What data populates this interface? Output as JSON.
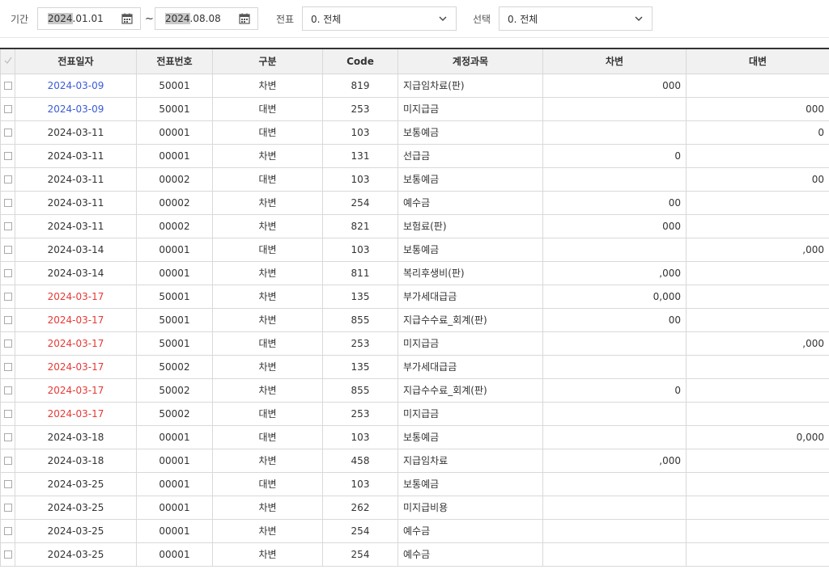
{
  "filters": {
    "period_label": "기간",
    "start_date_highlight": "2024",
    "start_date_rest": ".01.01",
    "tilde": "~",
    "end_date_highlight": "2024",
    "end_date_rest": ".08.08",
    "voucher_label": "전표",
    "voucher_value": "0. 전체",
    "select_label": "선택",
    "select_value": "0. 전체"
  },
  "table": {
    "headers": [
      "전표일자",
      "전표번호",
      "구분",
      "Code",
      "계정과목",
      "차변",
      "대변"
    ],
    "rows": [
      {
        "date": "2024-03-09",
        "color": "blue",
        "no": "50001",
        "type": "차변",
        "code": "819",
        "account": "지급임차료(판)",
        "debit": "000",
        "credit": ""
      },
      {
        "date": "2024-03-09",
        "color": "blue",
        "no": "50001",
        "type": "대변",
        "code": "253",
        "account": "미지급금",
        "debit": "",
        "credit": "000"
      },
      {
        "date": "2024-03-11",
        "color": "default",
        "no": "00001",
        "type": "대변",
        "code": "103",
        "account": "보통예금",
        "debit": "",
        "credit": "0"
      },
      {
        "date": "2024-03-11",
        "color": "default",
        "no": "00001",
        "type": "차변",
        "code": "131",
        "account": "선급금",
        "debit": "0",
        "credit": ""
      },
      {
        "date": "2024-03-11",
        "color": "default",
        "no": "00002",
        "type": "대변",
        "code": "103",
        "account": "보통예금",
        "debit": "",
        "credit": "00"
      },
      {
        "date": "2024-03-11",
        "color": "default",
        "no": "00002",
        "type": "차변",
        "code": "254",
        "account": "예수금",
        "debit": "00",
        "credit": ""
      },
      {
        "date": "2024-03-11",
        "color": "default",
        "no": "00002",
        "type": "차변",
        "code": "821",
        "account": "보험료(판)",
        "debit": "000",
        "credit": ""
      },
      {
        "date": "2024-03-14",
        "color": "default",
        "no": "00001",
        "type": "대변",
        "code": "103",
        "account": "보통예금",
        "debit": "",
        "credit": ",000"
      },
      {
        "date": "2024-03-14",
        "color": "default",
        "no": "00001",
        "type": "차변",
        "code": "811",
        "account": "복리후생비(판)",
        "debit": ",000",
        "credit": ""
      },
      {
        "date": "2024-03-17",
        "color": "red",
        "no": "50001",
        "type": "차변",
        "code": "135",
        "account": "부가세대급금",
        "debit": "0,000",
        "credit": ""
      },
      {
        "date": "2024-03-17",
        "color": "red",
        "no": "50001",
        "type": "차변",
        "code": "855",
        "account": "지급수수료_회계(판)",
        "debit": "00",
        "credit": ""
      },
      {
        "date": "2024-03-17",
        "color": "red",
        "no": "50001",
        "type": "대변",
        "code": "253",
        "account": "미지급금",
        "debit": "",
        "credit": ",000"
      },
      {
        "date": "2024-03-17",
        "color": "red",
        "no": "50002",
        "type": "차변",
        "code": "135",
        "account": "부가세대급금",
        "debit": "",
        "credit": ""
      },
      {
        "date": "2024-03-17",
        "color": "red",
        "no": "50002",
        "type": "차변",
        "code": "855",
        "account": "지급수수료_회계(판)",
        "debit": "0",
        "credit": ""
      },
      {
        "date": "2024-03-17",
        "color": "red",
        "no": "50002",
        "type": "대변",
        "code": "253",
        "account": "미지급금",
        "debit": "",
        "credit": ""
      },
      {
        "date": "2024-03-18",
        "color": "default",
        "no": "00001",
        "type": "대변",
        "code": "103",
        "account": "보통예금",
        "debit": "",
        "credit": "0,000"
      },
      {
        "date": "2024-03-18",
        "color": "default",
        "no": "00001",
        "type": "차변",
        "code": "458",
        "account": "지급임차료",
        "debit": ",000",
        "credit": ""
      },
      {
        "date": "2024-03-25",
        "color": "default",
        "no": "00001",
        "type": "대변",
        "code": "103",
        "account": "보통예금",
        "debit": "",
        "credit": ""
      },
      {
        "date": "2024-03-25",
        "color": "default",
        "no": "00001",
        "type": "차변",
        "code": "262",
        "account": "미지급비용",
        "debit": "",
        "credit": ""
      },
      {
        "date": "2024-03-25",
        "color": "default",
        "no": "00001",
        "type": "차변",
        "code": "254",
        "account": "예수금",
        "debit": "",
        "credit": ""
      },
      {
        "date": "2024-03-25",
        "color": "default",
        "no": "00001",
        "type": "차변",
        "code": "254",
        "account": "예수금",
        "debit": "",
        "credit": ""
      }
    ]
  },
  "colors": {
    "blue": "#3b5bd8",
    "red": "#e53935",
    "header_border": "#333333"
  },
  "icons": {
    "calendar": "calendar-icon",
    "chevron": "chevron-down-icon",
    "checkmark": "checkmark-icon"
  }
}
